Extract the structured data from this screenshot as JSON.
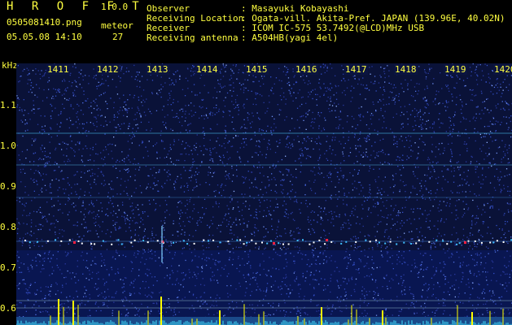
{
  "header": {
    "app_title": "H R O F F T",
    "app_version": "1.0.0",
    "file_name": "0505081410.png",
    "meteor_label": "meteor",
    "meteor_count": "27",
    "datetime": "05.05.08 14:10",
    "observer_key": "Observer",
    "observer_val": ": Masayuki Kobayashi",
    "location_key": "Receiving Location",
    "location_val": ": Ogata-vill. Akita-Pref. JAPAN (139.96E, 40.02N)",
    "receiver_key": "Receiver",
    "receiver_val": ": ICOM IC-575 53.7492(@LCD)MHz USB",
    "antenna_key": "Receiving antenna",
    "antenna_val": ": A504HB(yagi 4el)"
  },
  "axis": {
    "unit": "kHz",
    "y_labels": [
      "1.1",
      "1.0",
      "0.9",
      "0.8",
      "0.7",
      "0.6"
    ],
    "time_labels": [
      "1411",
      "1412",
      "1413",
      "1414",
      "1415",
      "1416",
      "1417",
      "1418",
      "1419",
      "1420"
    ]
  },
  "colors": {
    "background": "#000000",
    "text": "#ffff40",
    "spectrogram_base": "#0a1238",
    "signal_line": "#40c0ff",
    "spikes": "#ffff00",
    "meteor_hit": "#ff2040"
  }
}
